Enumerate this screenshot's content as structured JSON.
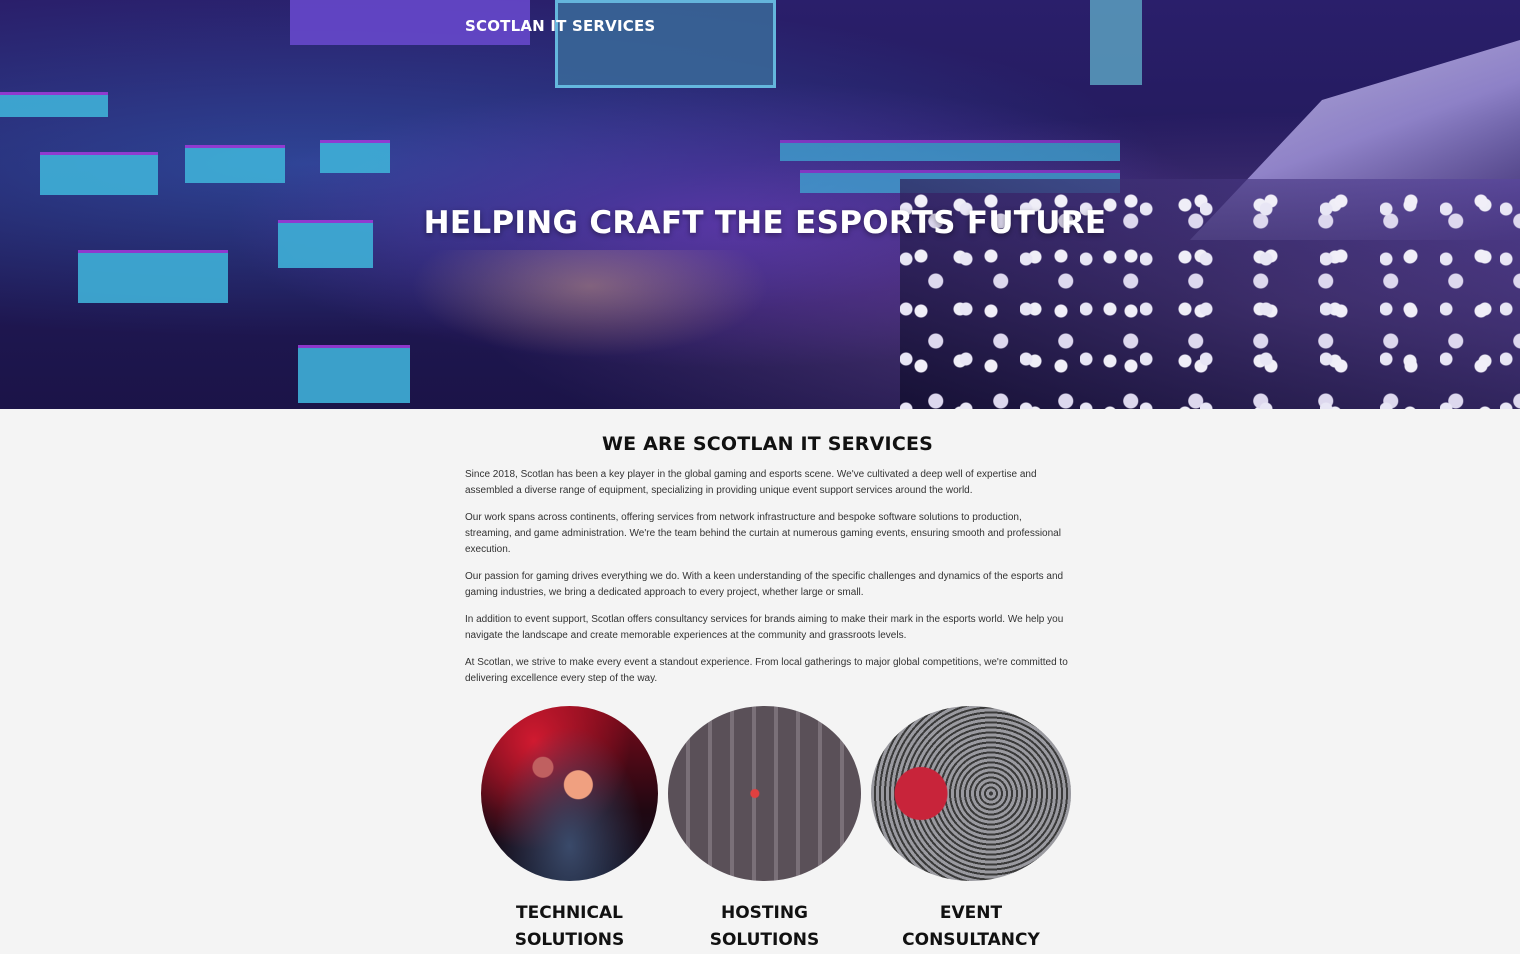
{
  "header": {
    "site_title": "SCOTLAN IT SERVICES"
  },
  "hero": {
    "heading": "HELPING CRAFT THE ESPORTS FUTURE"
  },
  "about": {
    "title": "WE ARE SCOTLAN IT SERVICES",
    "paragraphs": [
      "Since 2018, Scotlan has been a key player in the global gaming and esports scene. We've cultivated a deep well of expertise and assembled a diverse range of equipment, specializing in providing unique event support services around the world.",
      "Our work spans across continents, offering services from network infrastructure and bespoke software solutions to production, streaming, and game administration. We're the team behind the curtain at numerous gaming events, ensuring smooth and professional execution.",
      "Our passion for gaming drives everything we do. With a keen understanding of the specific challenges and dynamics of the esports and gaming industries, we bring a dedicated approach to every project, whether large or small.",
      "In addition to event support, Scotlan offers consultancy services for brands aiming to make their mark in the esports world. We help you navigate the landscape and create memorable experiences at the community and grassroots levels.",
      "At Scotlan, we strive to make every event a standout experience. From local gatherings to major global competitions, we're committed to delivering excellence every step of the way."
    ]
  },
  "services": [
    {
      "line1": "TECHNICAL",
      "line2": "SOLUTIONS"
    },
    {
      "line1": "HOSTING",
      "line2": "SOLUTIONS"
    },
    {
      "line1": "EVENT",
      "line2": "CONSULTANCY"
    }
  ]
}
